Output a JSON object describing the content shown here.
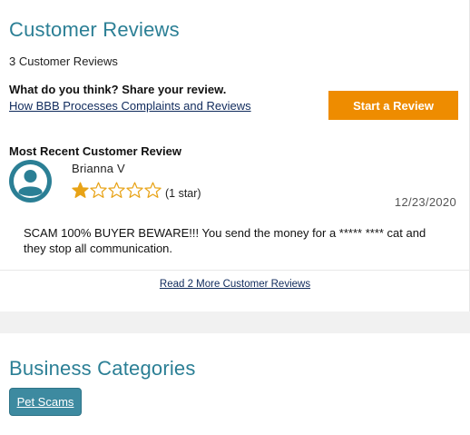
{
  "reviews": {
    "title": "Customer Reviews",
    "count_text": "3 Customer Reviews",
    "share_prompt": "What do you think? Share your review.",
    "process_link": "How BBB Processes Complaints and Reviews",
    "start_button": "Start a Review",
    "recent_heading": "Most Recent Customer Review",
    "review": {
      "reviewer": "Brianna V",
      "stars_filled": 1,
      "stars_total": 5,
      "rating_text": "(1 star)",
      "date": "12/23/2020",
      "text": "SCAM 100% BUYER BEWARE!!! You send the money for a ***** **** cat and they stop all communication."
    },
    "more_link": "Read 2 More Customer Reviews"
  },
  "categories": {
    "title": "Business Categories",
    "tags": [
      "Pet Scams"
    ]
  },
  "colors": {
    "accent": "#2b7f95",
    "button": "#ee8c00",
    "star": "#e8a317",
    "tag": "#3d8aa0"
  }
}
